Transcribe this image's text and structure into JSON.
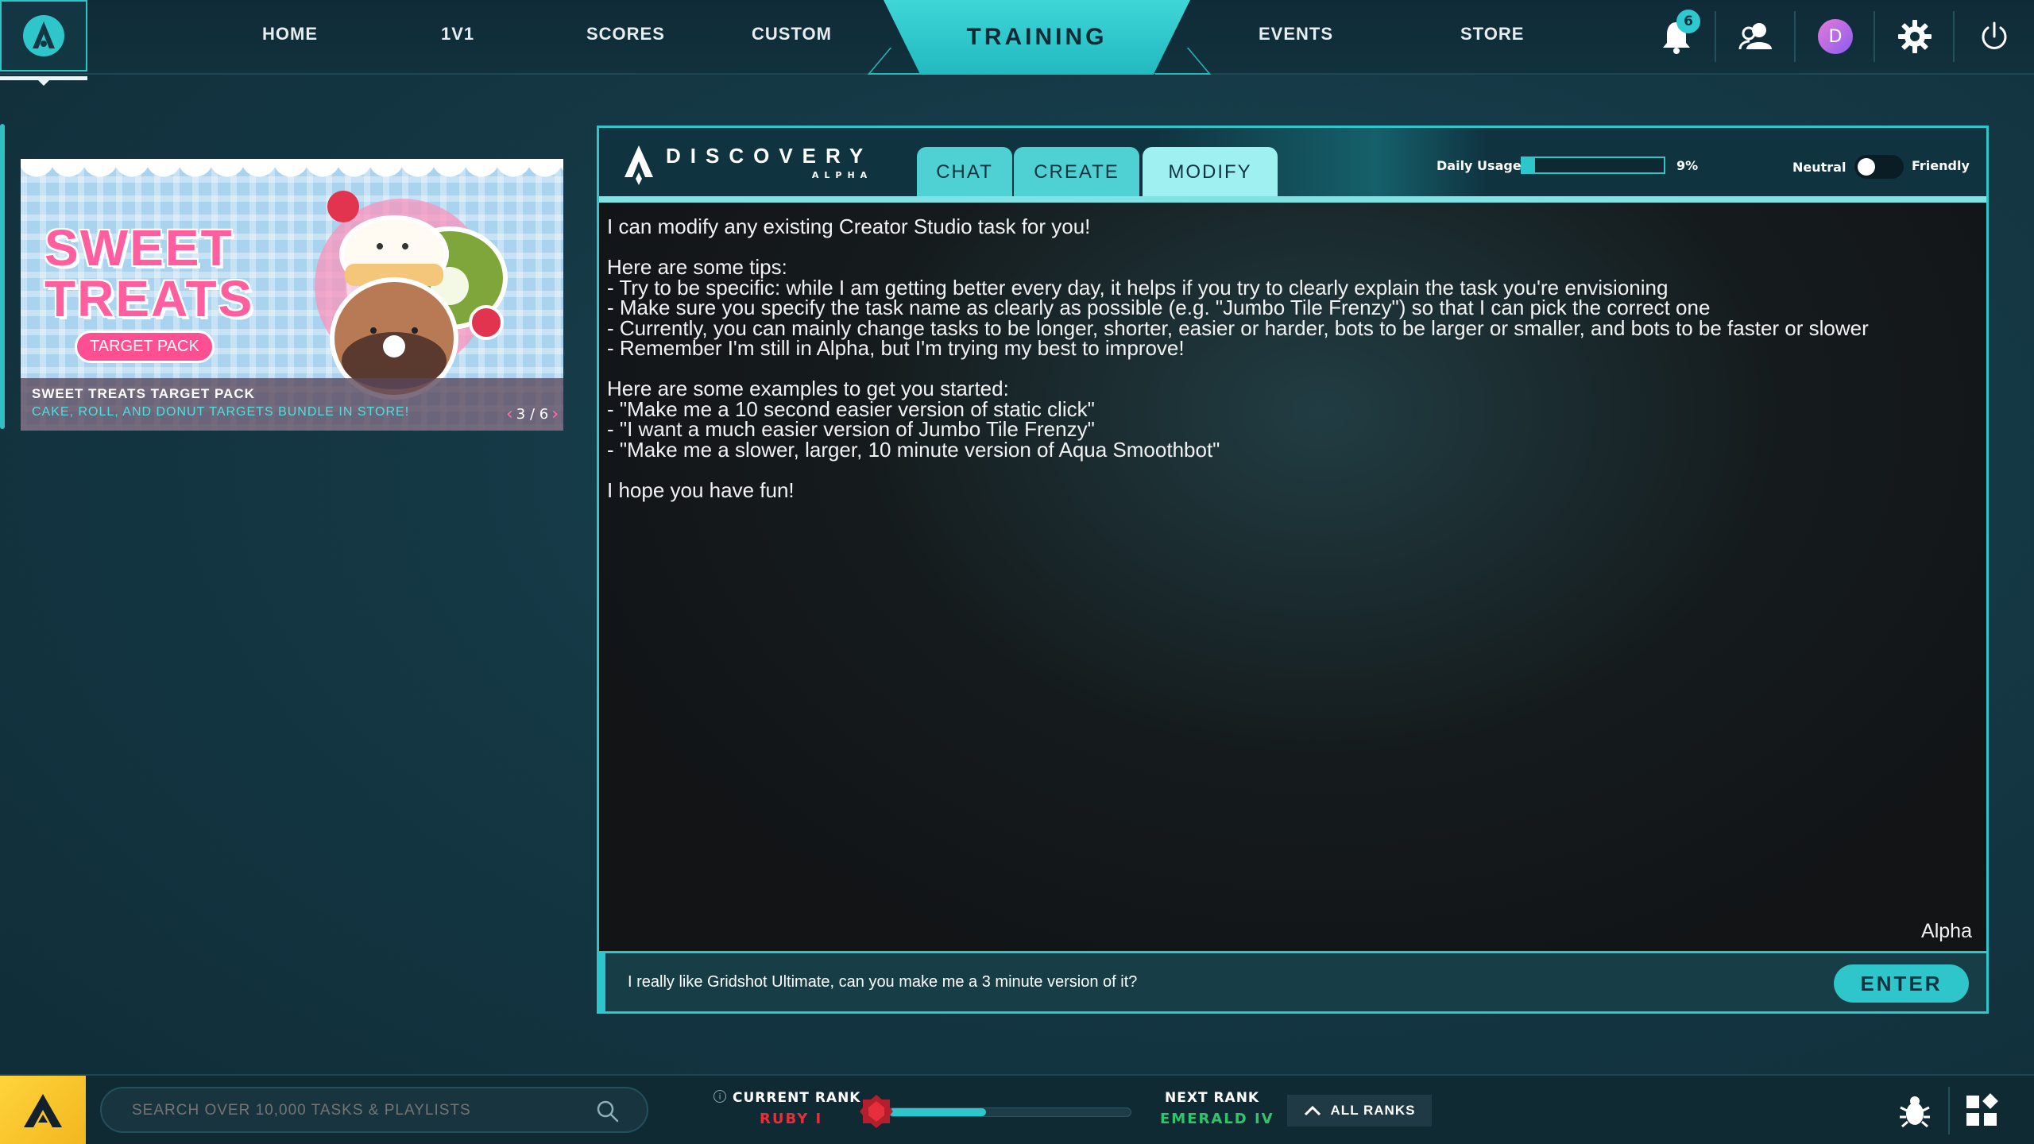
{
  "nav": {
    "items": [
      "HOME",
      "1V1",
      "SCORES",
      "CUSTOM",
      "EVENTS",
      "STORE"
    ],
    "active": "TRAINING",
    "notification_count": "6",
    "avatar_initial": "D"
  },
  "promo": {
    "title_line1": "SWEET",
    "title_line2": "TREATS",
    "pill": "TARGET PACK",
    "name": "SWEET TREATS TARGET PACK",
    "subtitle": "CAKE, ROLL, AND DONUT TARGETS BUNDLE IN STORE!",
    "pager": "3 / 6"
  },
  "discovery": {
    "logo_word": "DISCOVERY",
    "logo_sub": "ALPHA",
    "tabs": [
      "CHAT",
      "CREATE",
      "MODIFY"
    ],
    "active_tab": "MODIFY",
    "usage_label": "Daily Usage",
    "usage_percent": 9,
    "usage_text": "9%",
    "tone_left": "Neutral",
    "tone_right": "Friendly",
    "messages": [
      "I can modify any existing Creator Studio task for you!",
      "",
      "Here are some tips:",
      "- Try to be specific: while I am getting better every day, it helps if you try to clearly explain the task you're envisioning",
      "- Make sure you specify the task name as clearly as possible (e.g. \"Jumbo Tile Frenzy\") so that I can pick the correct one",
      "- Currently, you can mainly change tasks to be longer, shorter, easier or harder, bots to be larger or smaller, and bots to be faster or slower",
      "- Remember I'm still in Alpha, but I'm trying my best to improve!",
      "",
      "Here are some examples to get you started:",
      "- \"Make me a 10 second easier version of static click\"",
      "- \"I want a much easier version of Jumbo Tile Frenzy\"",
      "- \"Make me a slower, larger, 10 minute version of Aqua Smoothbot\"",
      "",
      "I hope you have fun!"
    ],
    "sender": "Alpha",
    "input_value": "I really like Gridshot Ultimate, can you make me a 3 minute version of it?",
    "enter_label": "ENTER"
  },
  "bottom": {
    "search_placeholder": "SEARCH OVER 10,000 TASKS & PLAYLISTS",
    "current_rank_label": "CURRENT RANK",
    "current_rank": "RUBY I",
    "rank_progress": 0.4,
    "next_rank_label": "NEXT RANK",
    "next_rank": "EMERALD IV",
    "all_ranks_label": "ALL RANKS"
  },
  "colors": {
    "accent": "#2ec6ca",
    "ruby": "#e52f3a",
    "emerald": "#2ec66a",
    "promo_pink": "#ff5e9f"
  }
}
